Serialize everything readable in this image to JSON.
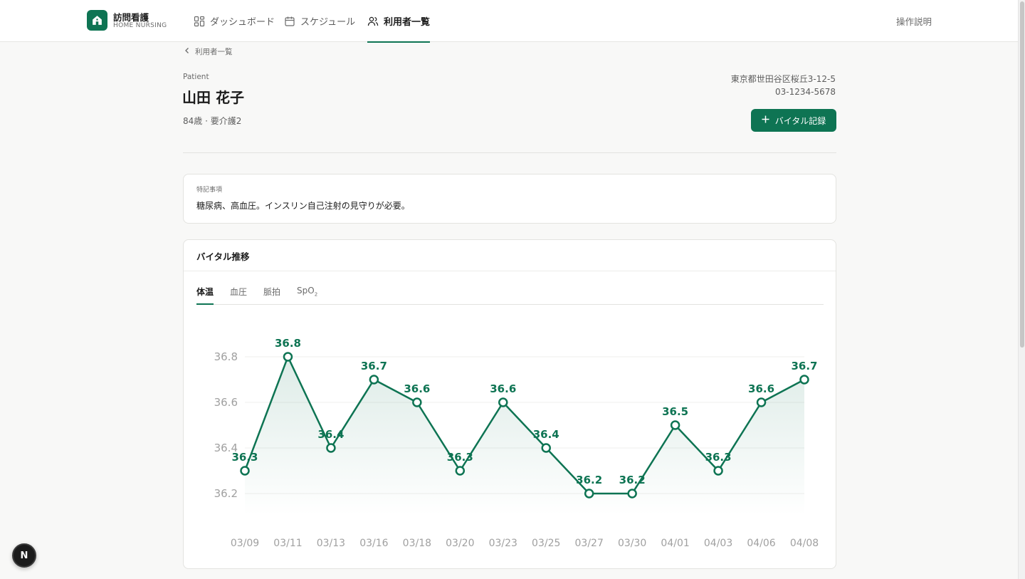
{
  "header": {
    "brand_name": "訪問看護",
    "brand_sub": "HOME NURSING",
    "nav": [
      {
        "label": "ダッシュボード",
        "icon": "grid-icon"
      },
      {
        "label": "スケジュール",
        "icon": "calendar-icon"
      },
      {
        "label": "利用者一覧",
        "icon": "users-icon",
        "active": true
      }
    ],
    "help": "操作説明"
  },
  "breadcrumb": {
    "back_label": "利用者一覧"
  },
  "patient": {
    "label": "Patient",
    "name": "山田 花子",
    "meta": "84歳 · 要介護2",
    "address": "東京都世田谷区桜丘3-12-5",
    "phone": "03-1234-5678"
  },
  "actions": {
    "add_vital": "バイタル記録"
  },
  "notes": {
    "label": "特記事項",
    "text": "糖尿病、高血圧。インスリン自己注射の見守りが必要。"
  },
  "vitals": {
    "title": "バイタル推移",
    "tabs": [
      {
        "label": "体温",
        "active": true
      },
      {
        "label": "血圧"
      },
      {
        "label": "脈拍"
      },
      {
        "label": "SpO",
        "sub": "2"
      }
    ]
  },
  "chart_data": {
    "type": "line",
    "categories": [
      "03/09",
      "03/11",
      "03/13",
      "03/16",
      "03/18",
      "03/20",
      "03/23",
      "03/25",
      "03/27",
      "03/30",
      "04/01",
      "04/03",
      "04/06",
      "04/08"
    ],
    "values": [
      36.3,
      36.8,
      36.4,
      36.7,
      36.6,
      36.3,
      36.6,
      36.4,
      36.2,
      36.2,
      36.5,
      36.3,
      36.6,
      36.7
    ],
    "y_ticks": [
      36.2,
      36.4,
      36.6,
      36.8
    ],
    "ylim": [
      36.2,
      36.8
    ],
    "grid": true,
    "area_fill": true,
    "data_labels": true,
    "color": "#0e7453"
  },
  "badge": {
    "letter": "N"
  },
  "colors": {
    "accent": "#0e7453",
    "background": "#f8f8f7"
  }
}
